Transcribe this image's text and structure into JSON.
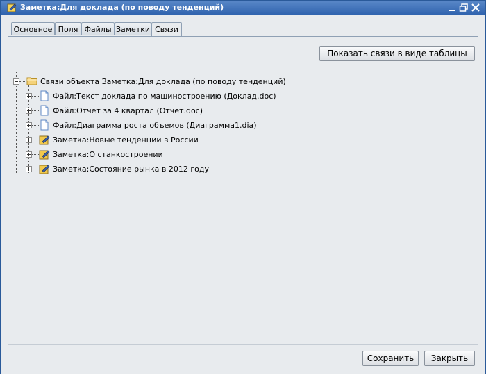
{
  "window": {
    "title": "Заметка:Для доклада (по поводу тенденций)"
  },
  "tabs": [
    {
      "label": "Основное",
      "active": false
    },
    {
      "label": "Поля",
      "active": false
    },
    {
      "label": "Файлы",
      "active": false
    },
    {
      "label": "Заметки",
      "active": false
    },
    {
      "label": "Связи",
      "active": true
    }
  ],
  "toolbar": {
    "show_table_label": "Показать связи в виде таблицы"
  },
  "tree": {
    "root": {
      "label": "Связи объекта Заметка:Для доклада (по поводу тенденций)",
      "icon": "folder-icon"
    },
    "items": [
      {
        "label": "Файл:Текст доклада по машиностроению (Доклад.doc)",
        "icon": "file-icon"
      },
      {
        "label": "Файл:Отчет за 4 квартал (Отчет.doc)",
        "icon": "file-icon"
      },
      {
        "label": "Файл:Диаграмма роста объемов (Диаграмма1.dia)",
        "icon": "file-icon"
      },
      {
        "label": "Заметка:Новые тенденции в России",
        "icon": "note-icon"
      },
      {
        "label": "Заметка:О станкостроении",
        "icon": "note-icon"
      },
      {
        "label": "Заметка:Состояние рынка в 2012 году",
        "icon": "note-icon"
      }
    ]
  },
  "footer": {
    "save_label": "Сохранить",
    "close_label": "Закрыть"
  },
  "colors": {
    "titlebar": "#2e62ad",
    "panel": "#e8ebee",
    "note_icon": "#f2c94c"
  }
}
